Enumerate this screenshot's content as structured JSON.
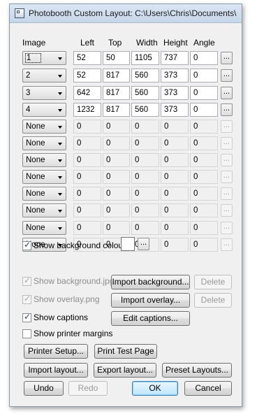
{
  "window": {
    "title": "Photobooth Custom Layout: C:\\Users\\Chris\\Documents\\"
  },
  "columns": {
    "image": "Image",
    "left": "Left",
    "top": "Top",
    "width": "Width",
    "height": "Height",
    "angle": "Angle"
  },
  "rows": [
    {
      "image": "1",
      "left": "52",
      "top": "50",
      "width": "1105",
      "height": "737",
      "angle": "0",
      "more": "..."
    },
    {
      "image": "2",
      "left": "52",
      "top": "817",
      "width": "560",
      "height": "373",
      "angle": "0",
      "more": "..."
    },
    {
      "image": "3",
      "left": "642",
      "top": "817",
      "width": "560",
      "height": "373",
      "angle": "0",
      "more": "..."
    },
    {
      "image": "4",
      "left": "1232",
      "top": "817",
      "width": "560",
      "height": "373",
      "angle": "0",
      "more": "..."
    },
    {
      "image": "None",
      "left": "0",
      "top": "0",
      "width": "0",
      "height": "0",
      "angle": "0",
      "more": "..."
    },
    {
      "image": "None",
      "left": "0",
      "top": "0",
      "width": "0",
      "height": "0",
      "angle": "0",
      "more": "..."
    },
    {
      "image": "None",
      "left": "0",
      "top": "0",
      "width": "0",
      "height": "0",
      "angle": "0",
      "more": "..."
    },
    {
      "image": "None",
      "left": "0",
      "top": "0",
      "width": "0",
      "height": "0",
      "angle": "0",
      "more": "..."
    },
    {
      "image": "None",
      "left": "0",
      "top": "0",
      "width": "0",
      "height": "0",
      "angle": "0",
      "more": "..."
    },
    {
      "image": "None",
      "left": "0",
      "top": "0",
      "width": "0",
      "height": "0",
      "angle": "0",
      "more": "..."
    },
    {
      "image": "None",
      "left": "0",
      "top": "0",
      "width": "0",
      "height": "0",
      "angle": "0",
      "more": "..."
    },
    {
      "image": "None",
      "left": "0",
      "top": "0",
      "width": "0",
      "height": "0",
      "angle": "0",
      "more": "..."
    }
  ],
  "options": {
    "show_background_colour": {
      "label": "Show background colour",
      "checked": true,
      "color": "#ffffff",
      "more": "..."
    },
    "show_background_jpg": {
      "label": "Show background.jpg",
      "checked": true,
      "enabled": false
    },
    "show_overlay_png": {
      "label": "Show overlay.png",
      "checked": true,
      "enabled": false
    },
    "show_captions": {
      "label": "Show captions",
      "checked": true
    },
    "show_printer_margins": {
      "label": "Show printer margins",
      "checked": false
    }
  },
  "buttons": {
    "import_background": "Import background...",
    "delete_background": "Delete",
    "import_overlay": "Import overlay...",
    "delete_overlay": "Delete",
    "edit_captions": "Edit captions...",
    "printer_setup": "Printer Setup...",
    "print_test_page": "Print Test Page",
    "import_layout": "Import layout...",
    "export_layout": "Export layout...",
    "preset_layouts": "Preset Layouts...",
    "undo": "Undo",
    "redo": "Redo",
    "ok": "OK",
    "cancel": "Cancel"
  },
  "glyphs": {
    "check": "✓"
  }
}
